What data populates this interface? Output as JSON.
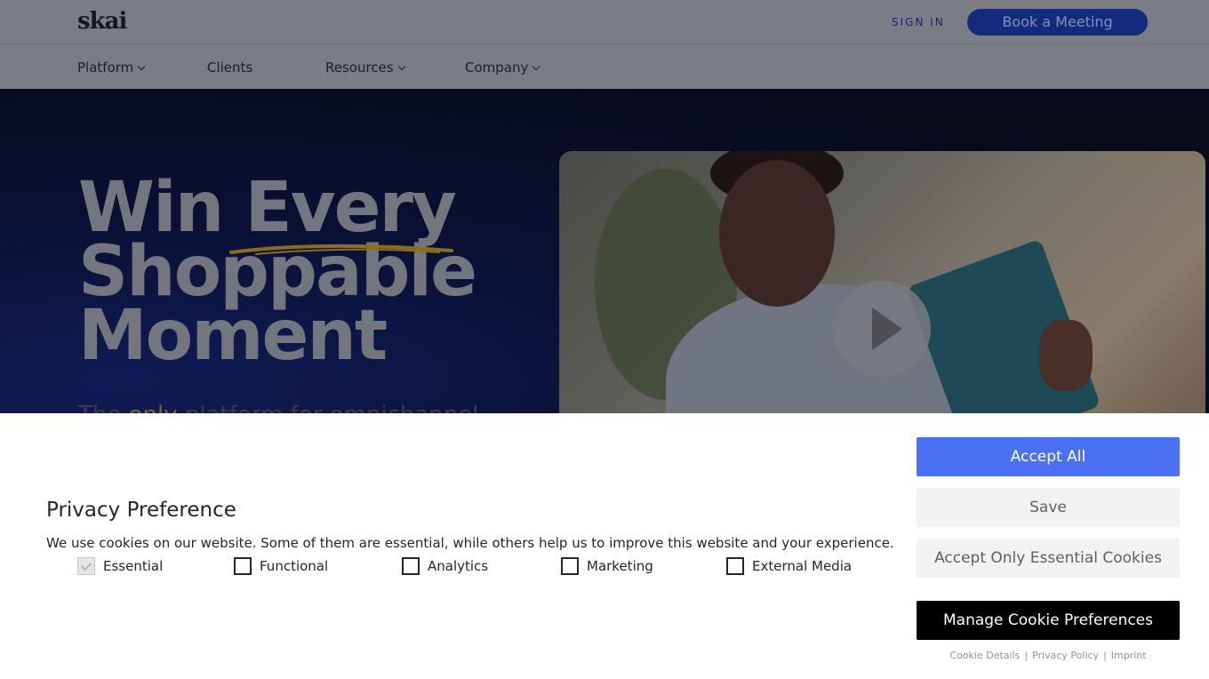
{
  "header": {
    "logo": "skai",
    "sign_in": "SIGN IN",
    "book_meeting": "Book a Meeting"
  },
  "nav": {
    "items": [
      {
        "label": "Platform",
        "has_dropdown": true
      },
      {
        "label": "Clients",
        "has_dropdown": false
      },
      {
        "label": "Resources",
        "has_dropdown": true
      },
      {
        "label": "Company",
        "has_dropdown": true
      }
    ]
  },
  "hero": {
    "headline_line1": "Win Every",
    "headline_line2": "Shoppable",
    "headline_line3": "Moment",
    "subtitle_prefix": "The ",
    "subtitle_highlight": "only",
    "subtitle_suffix": " platform for omnichannel",
    "accent_color": "#c9a227",
    "video_play_icon": "play-icon"
  },
  "cookie_banner": {
    "title": "Privacy Preference",
    "description": "We use cookies on our website. Some of them are essential, while others help us to improve this website and your experience.",
    "options": [
      {
        "label": "Essential",
        "checked": true
      },
      {
        "label": "Functional",
        "checked": false
      },
      {
        "label": "Analytics",
        "checked": false
      },
      {
        "label": "Marketing",
        "checked": false
      },
      {
        "label": "External Media",
        "checked": false
      }
    ],
    "buttons": {
      "accept_all": "Accept All",
      "save": "Save",
      "accept_essential": "Accept Only Essential Cookies",
      "manage": "Manage Cookie Preferences"
    },
    "links": {
      "cookie_details": "Cookie Details",
      "privacy_policy": "Privacy Policy",
      "imprint": "Imprint",
      "separator": "|"
    },
    "colors": {
      "accept_all_bg": "#4a71f2",
      "manage_bg": "#000000"
    }
  }
}
